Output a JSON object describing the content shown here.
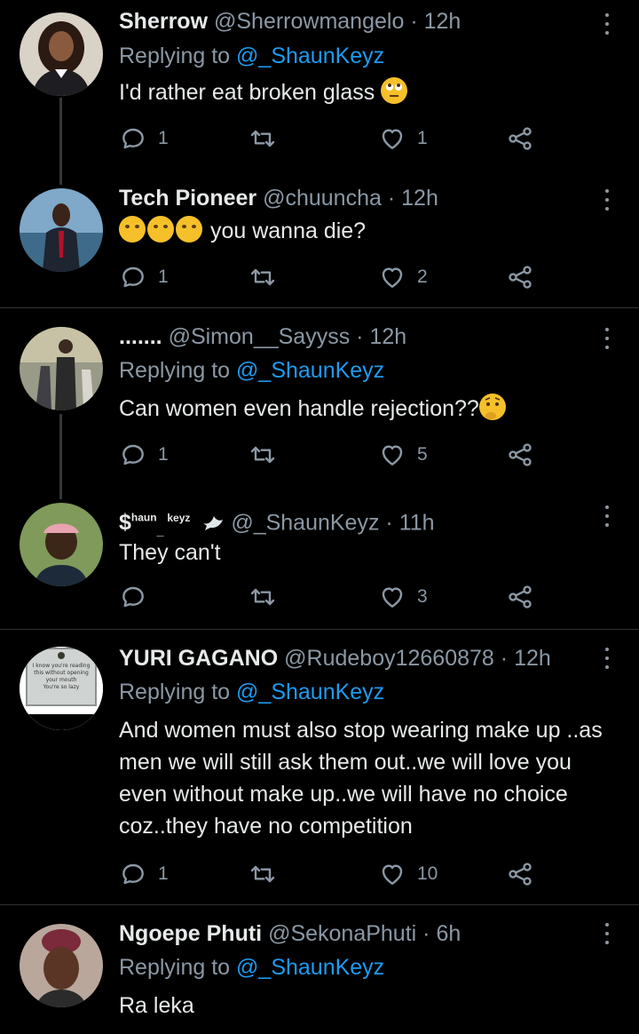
{
  "tweets": [
    {
      "name": "Sherrow",
      "handle": "@Sherrowmangelo",
      "time": "12h",
      "reply_prefix": "Replying to ",
      "reply_to": "@_ShaunKeyz",
      "text": "I'd rather eat broken glass",
      "emoji": [
        "rolling-eyes-emoji"
      ],
      "replies": "1",
      "retweets": "",
      "likes": "1",
      "avatar_color": "#d9d2c6"
    },
    {
      "name": "Tech Pioneer",
      "handle": "@chuuncha",
      "time": "12h",
      "text_prefix_emoji": [
        "rofl-emoji",
        "rofl-emoji",
        "rofl-emoji"
      ],
      "text": "you wanna die?",
      "replies": "1",
      "retweets": "",
      "likes": "2",
      "avatar_color": "#4a6f8e"
    },
    {
      "name": ".......",
      "handle": "@Simon__Sayyss",
      "time": "12h",
      "reply_prefix": "Replying to ",
      "reply_to": "@_ShaunKeyz",
      "text": "Can women even handle rejection??",
      "emoji": [
        "thinking-face-emoji"
      ],
      "replies": "1",
      "retweets": "",
      "likes": "5",
      "avatar_color": "#6b6a5a"
    },
    {
      "name_parts": [
        "$",
        "haun",
        "keyz",
        "_"
      ],
      "handle": "@_ShaunKeyz",
      "time": "11h",
      "text": "They can't",
      "replies": "",
      "retweets": "",
      "likes": "3",
      "avatar_color": "#5f7a4a"
    },
    {
      "name": "YURI GAGANO",
      "handle": "@Rudeboy12660878",
      "time": "12h",
      "reply_prefix": "Replying to ",
      "reply_to": "@_ShaunKeyz",
      "text": "And women must also stop wearing make up ..as men we will still ask them out..we will love you even without make up..we will have no choice coz..they have no competition",
      "avatar_sign_lines": [
        "I know you're reading",
        "this without opening",
        "your mouth",
        "You're so lazy"
      ],
      "replies": "1",
      "retweets": "",
      "likes": "10",
      "avatar_color": "#cfd3d1"
    },
    {
      "name": "Ngoepe Phuti",
      "handle": "@SekonaPhuti",
      "time": "6h",
      "reply_prefix": "Replying to ",
      "reply_to": "@_ShaunKeyz",
      "text": "Ra leka",
      "avatar_color": "#6b4a3a"
    }
  ],
  "colors": {
    "background": "#000000",
    "text": "#e7e9ea",
    "muted": "#8b98a5",
    "link": "#1d9bf0",
    "separator": "#2f3336"
  },
  "icons": [
    "reply-icon",
    "retweet-icon",
    "like-icon",
    "share-icon",
    "more-options-icon"
  ]
}
